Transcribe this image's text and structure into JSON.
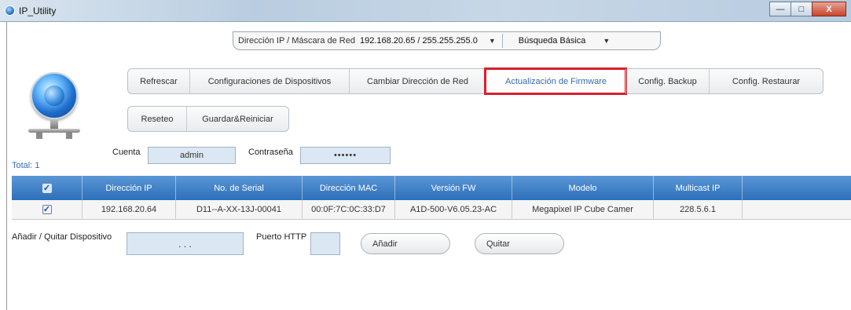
{
  "window": {
    "title": "IP_Utility",
    "minimize": "—",
    "maximize": "□",
    "close": "X"
  },
  "topbar": {
    "ip_mask_label": "Dirección IP / Máscara de Red",
    "ip_mask_value": "192.168.20.65 / 255.255.255.0",
    "search_mode": "Búsqueda Básica"
  },
  "toolbar": {
    "row1": [
      "Refrescar",
      "Configuraciones de Dispositivos",
      "Cambiar Dirección de Red",
      "Actualización de Firmware",
      "Config. Backup",
      "Config. Restaurar"
    ],
    "row2": [
      "Reseteo",
      "Guardar&Reiniciar"
    ],
    "highlighted": "Actualización de Firmware",
    "highlight_color": "#d8202d"
  },
  "credentials": {
    "account_label": "Cuenta",
    "account_value": "admin",
    "password_label": "Contraseña",
    "password_value": "••••••"
  },
  "total_label": "Total: 1",
  "table": {
    "columns": [
      "Dirección IP",
      "No. de Serial",
      "Dirección MAC",
      "Versión FW",
      "Modelo",
      "Multicast IP"
    ],
    "rows": [
      {
        "checked": true,
        "ip": "192.168.20.64",
        "serial": "D11--A-XX-13J-00041",
        "mac": "00:0F:7C:0C:33:D7",
        "fw": "A1D-500-V6.05.23-AC",
        "model": "Megapixel IP Cube Camer",
        "multicast": "228.5.6.1"
      }
    ],
    "header_color": "#2d6fb9"
  },
  "add_remove": {
    "label": "Añadir / Quitar Dispositivo",
    "ip_dots": ".  .  .",
    "port_label": "Puerto HTTP",
    "add_button": "Añadir",
    "remove_button": "Quitar"
  }
}
